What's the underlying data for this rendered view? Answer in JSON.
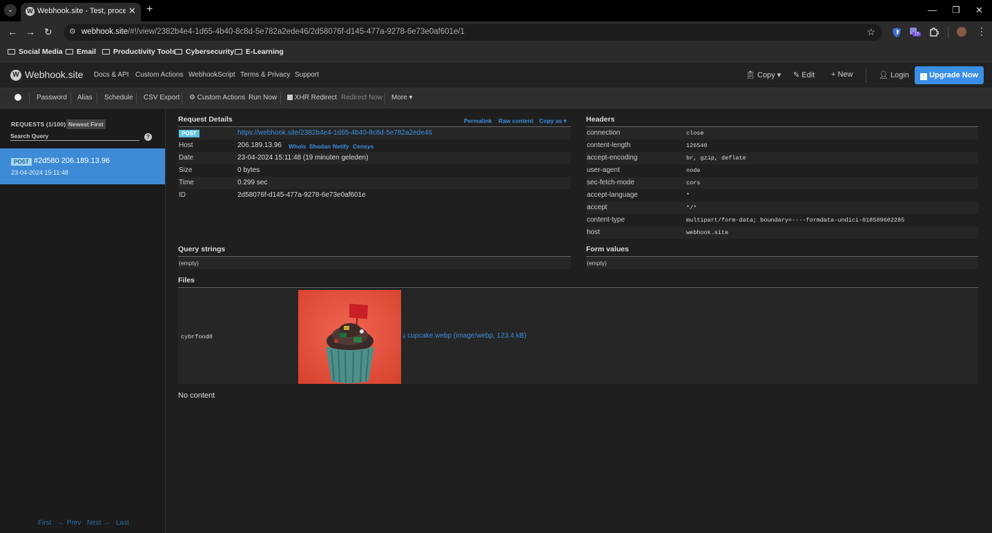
{
  "browser": {
    "tab_title": "Webhook.site - Test, process a",
    "tab_favicon": "webhook-favicon",
    "url_host": "webhook.site",
    "url_rest": "/#!/view/2382b4e4-1d65-4b40-8c8d-5e782a2ede46/2d58076f-d145-477a-9278-6e73e0af601e/1",
    "bookmarks": [
      "Social Media",
      "Email",
      "Productivity Tools",
      "Cybersecurity",
      "E-Learning"
    ],
    "extension_badge": "15"
  },
  "nav": {
    "brand": "Webhook.site",
    "links": [
      "Docs & API",
      "Custom Actions",
      "WebhookScript",
      "Terms & Privacy",
      "Support"
    ],
    "copy": "Copy ▾",
    "edit": "Edit",
    "new": "+ New",
    "login": "Login",
    "upgrade": "Upgrade Now"
  },
  "subbar": {
    "password": "Password",
    "alias": "Alias",
    "schedule": "Schedule",
    "csv_export": "CSV Export",
    "custom_actions": "Custom Actions",
    "run_now": "Run Now",
    "xhr_redirect": "XHR Redirect",
    "redirect_now": "Redirect Now",
    "more": "More ▾"
  },
  "sidebar": {
    "requests_label": "REQUESTS (1/100)",
    "newest_first": "Newest First",
    "search_placeholder": "Search Query",
    "request": {
      "method": "POST",
      "title": "#2d580 206.189.13.96",
      "date": "23-04-2024 15:11:48"
    },
    "pager": {
      "first": "First",
      "prev": "← Prev",
      "next": "Next →",
      "last": "Last"
    }
  },
  "details": {
    "title": "Request Details",
    "permalink": "Permalink",
    "raw_content": "Raw content",
    "copy_as": "Copy as ▾",
    "method": "POST",
    "url": "https://webhook.site/2382b4e4-1d65-4b40-8c8d-5e782a2ede46",
    "rows": [
      {
        "label": "Host",
        "value": "206.189.13.96"
      },
      {
        "label": "Date",
        "value": "23-04-2024 15:11:48 (19 minuten geleden)"
      },
      {
        "label": "Size",
        "value": "0 bytes"
      },
      {
        "label": "Time",
        "value": "0.299 sec"
      },
      {
        "label": "ID",
        "value": "2d58076f-d145-477a-9278-6e73e0af601e"
      }
    ],
    "host_links": [
      "Whois",
      "Shodan",
      "Netify",
      "Censys"
    ]
  },
  "headers": {
    "title": "Headers",
    "rows": [
      {
        "label": "connection",
        "value": "close"
      },
      {
        "label": "content-length",
        "value": "126540"
      },
      {
        "label": "accept-encoding",
        "value": "br, gzip, deflate"
      },
      {
        "label": "user-agent",
        "value": "node"
      },
      {
        "label": "sec-fetch-mode",
        "value": "cors"
      },
      {
        "label": "accept-language",
        "value": "*"
      },
      {
        "label": "accept",
        "value": "*/*"
      },
      {
        "label": "content-type",
        "value": "multipart/form-data; boundary=----formdata-undici-018589602285"
      },
      {
        "label": "host",
        "value": "webhook.site"
      }
    ]
  },
  "query": {
    "title": "Query strings",
    "empty": "(empty)"
  },
  "form": {
    "title": "Form values",
    "empty": "(empty)"
  },
  "files": {
    "title": "Files",
    "field": "cybrfood0",
    "link": "cupcake.webp (image/webp, 123.4 kB)"
  },
  "no_content": "No content",
  "colors": {
    "accent": "#3a8ee6",
    "selected_request": "#3d8bd7",
    "post_badge": "#5bc0de",
    "cupcake_bg": "#e4503f"
  }
}
